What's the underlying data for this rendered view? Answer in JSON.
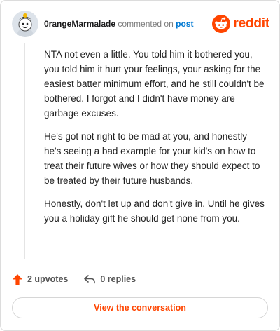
{
  "header": {
    "username": "0rangeMarmalade",
    "action_text": "commented on",
    "link_text": "post"
  },
  "logo": {
    "wordmark": "reddit"
  },
  "comment": {
    "paragraphs": [
      "NTA not even a little. You told him it bothered you, you told him it hurt your feelings, your asking for the easiest batter minimum effort, and he still couldn't be bothered. I forgot and I didn't have money are garbage excuses.",
      "He's got not right to be mad at you, and honestly he's seeing a bad example for your kid's on how to treat their future wives or how they should expect to be treated by their future husbands.",
      "Honestly, don't let up and don't give in. Until he gives you a holiday gift he should get none from you."
    ]
  },
  "footer": {
    "upvotes": "2 upvotes",
    "replies": "0 replies"
  },
  "cta": {
    "label": "View the conversation"
  },
  "colors": {
    "accent": "#ff4500",
    "link": "#0079d3",
    "border": "#dcdcdc"
  }
}
